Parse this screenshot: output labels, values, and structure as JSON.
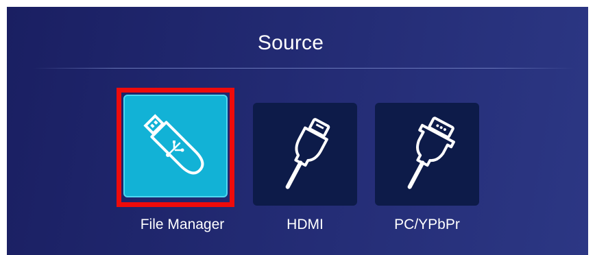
{
  "header": {
    "title": "Source"
  },
  "sources": [
    {
      "label": "File Manager",
      "icon": "usb-drive-icon",
      "selected": true
    },
    {
      "label": "HDMI",
      "icon": "hdmi-cable-icon",
      "selected": false
    },
    {
      "label": "PC/YPbPr",
      "icon": "vga-cable-icon",
      "selected": false
    }
  ],
  "colors": {
    "background": "#222a72",
    "tile": "#0d1b49",
    "tile_selected": "#12b2d6",
    "focus_frame": "#ef0b0b"
  }
}
